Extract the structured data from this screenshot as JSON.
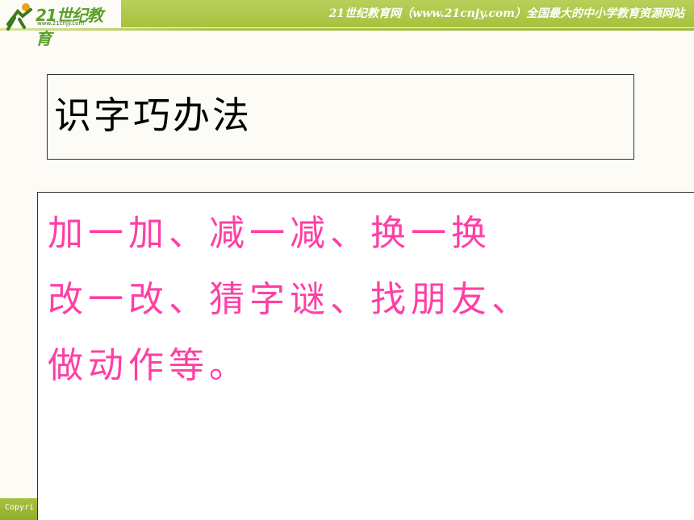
{
  "header": {
    "logo_text": "21世纪教育",
    "logo_subtext": "www.21cnjy.com",
    "site_caption": "21世纪教育网（www.21cnjy.com）全国最大的中小学教育资源网站"
  },
  "slide": {
    "title": "识字巧办法",
    "lines": [
      "加一加、减一减、换一换",
      "改一改、猜字谜、找朋友、",
      "做动作等。"
    ]
  },
  "footer": {
    "copyright_text": "Copyri"
  },
  "colors": {
    "accent_green": "#a7c13d",
    "content_text": "#ff3fa5",
    "title_text": "#000000"
  }
}
